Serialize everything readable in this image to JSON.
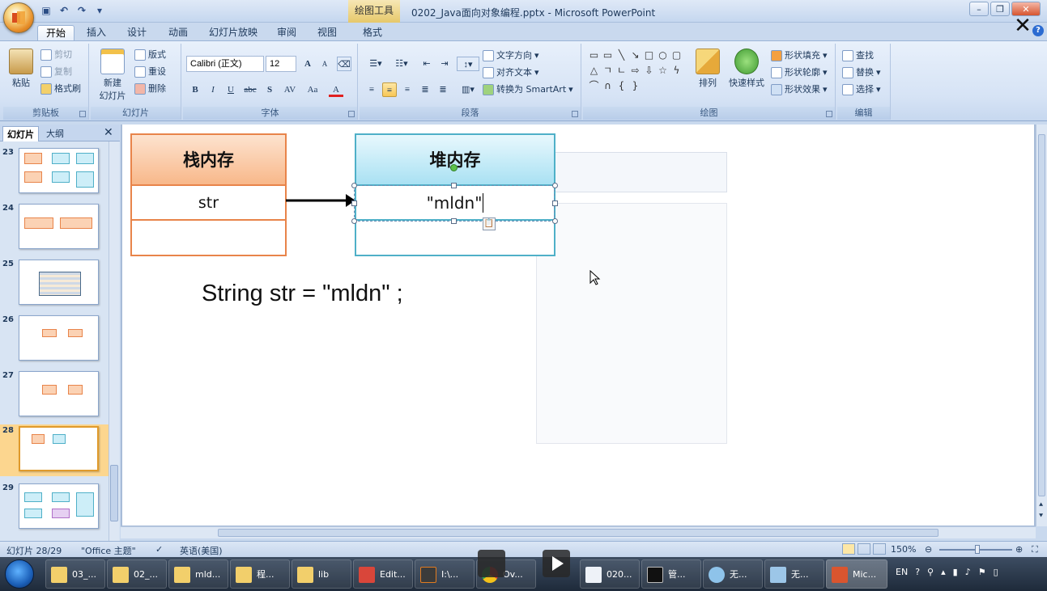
{
  "window": {
    "title": "0202_Java面向对象编程.pptx - Microsoft PowerPoint",
    "contextual_tab_group": "绘图工具"
  },
  "ribbon": {
    "tabs": [
      "开始",
      "插入",
      "设计",
      "动画",
      "幻灯片放映",
      "审阅",
      "视图",
      "格式"
    ],
    "active_tab": "开始",
    "clipboard": {
      "paste": "粘贴",
      "cut": "剪切",
      "copy": "复制",
      "format_painter": "格式刷",
      "label": "剪贴板"
    },
    "slides": {
      "new_slide": "新建",
      "new_slide_2": "幻灯片",
      "layout": "版式",
      "reset": "重设",
      "delete": "删除",
      "label": "幻灯片"
    },
    "font": {
      "name": "Calibri (正文)",
      "size": "12",
      "label": "字体",
      "bold": "B",
      "italic": "I",
      "underline": "U",
      "strike": "abc",
      "shadow": "S",
      "spacing": "AV",
      "case": "Aa",
      "color": "A"
    },
    "paragraph": {
      "text_direction": "文字方向",
      "align_text": "对齐文本",
      "smartart": "转换为 SmartArt",
      "label": "段落"
    },
    "drawing": {
      "arrange": "排列",
      "quick_styles": "快速样式",
      "fill": "形状填充",
      "outline": "形状轮廓",
      "effects": "形状效果",
      "label": "绘图"
    },
    "editing": {
      "find": "查找",
      "replace": "替换",
      "select": "选择",
      "label": "编辑"
    }
  },
  "left_pane": {
    "tab_slides": "幻灯片",
    "tab_outline": "大纲",
    "slides": [
      {
        "num": "23",
        "selected": false
      },
      {
        "num": "24",
        "selected": false
      },
      {
        "num": "25",
        "selected": false
      },
      {
        "num": "26",
        "selected": false
      },
      {
        "num": "27",
        "selected": false
      },
      {
        "num": "28",
        "selected": true
      },
      {
        "num": "29",
        "selected": false
      }
    ]
  },
  "slide": {
    "stack_title": "栈内存",
    "stack_var": "str",
    "heap_title": "堆内存",
    "heap_value": "\"mldn\"",
    "code": "String str = \"mldn\" ;",
    "colors": {
      "stack_header": "#f8b88a",
      "stack_border": "#e8844a",
      "heap_header": "#b6e6f5",
      "heap_border": "#4fb0c8"
    }
  },
  "statusbar": {
    "slide_pos": "幻灯片 28/29",
    "theme": "\"Office 主题\"",
    "language": "英语(美国)",
    "zoom": "150%"
  },
  "taskbar": {
    "items": [
      "03_...",
      "02_...",
      "mld...",
      "程...",
      "lib",
      "Edit...",
      "I:\\...",
      "Ov...",
      "020...",
      "管...",
      "无...",
      "无...",
      "Mic..."
    ],
    "tray": {
      "lang": "EN"
    }
  }
}
